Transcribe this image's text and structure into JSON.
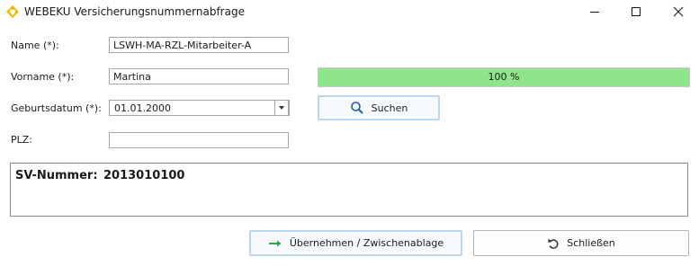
{
  "window": {
    "title": "WEBEKU Versicherungsnummernabfrage",
    "app_icon": "heart-diamond-icon",
    "controls": [
      "minimize-icon",
      "maximize-icon",
      "close-icon"
    ]
  },
  "form": {
    "name_label": "Name (*):",
    "name_value": "LSWH-MA-RZL-Mitarbeiter-A",
    "vorname_label": "Vorname (*):",
    "vorname_value": "Martina",
    "geburtsdatum_label": "Geburtsdatum (*):",
    "geburtsdatum_value": "01.01.2000",
    "plz_label": "PLZ:",
    "plz_value": ""
  },
  "progress": {
    "text": "100 %",
    "value": 1.0,
    "color": "#8ee58a"
  },
  "search_button": {
    "label": "Suchen",
    "icon": "search-icon"
  },
  "result": {
    "label": "SV-Nummer:",
    "value": "2013010100"
  },
  "footer": {
    "apply_label": "Übernehmen / Zwischenablage",
    "apply_icon": "arrow-right-icon",
    "close_label": "Schließen",
    "close_icon": "undo-icon"
  }
}
